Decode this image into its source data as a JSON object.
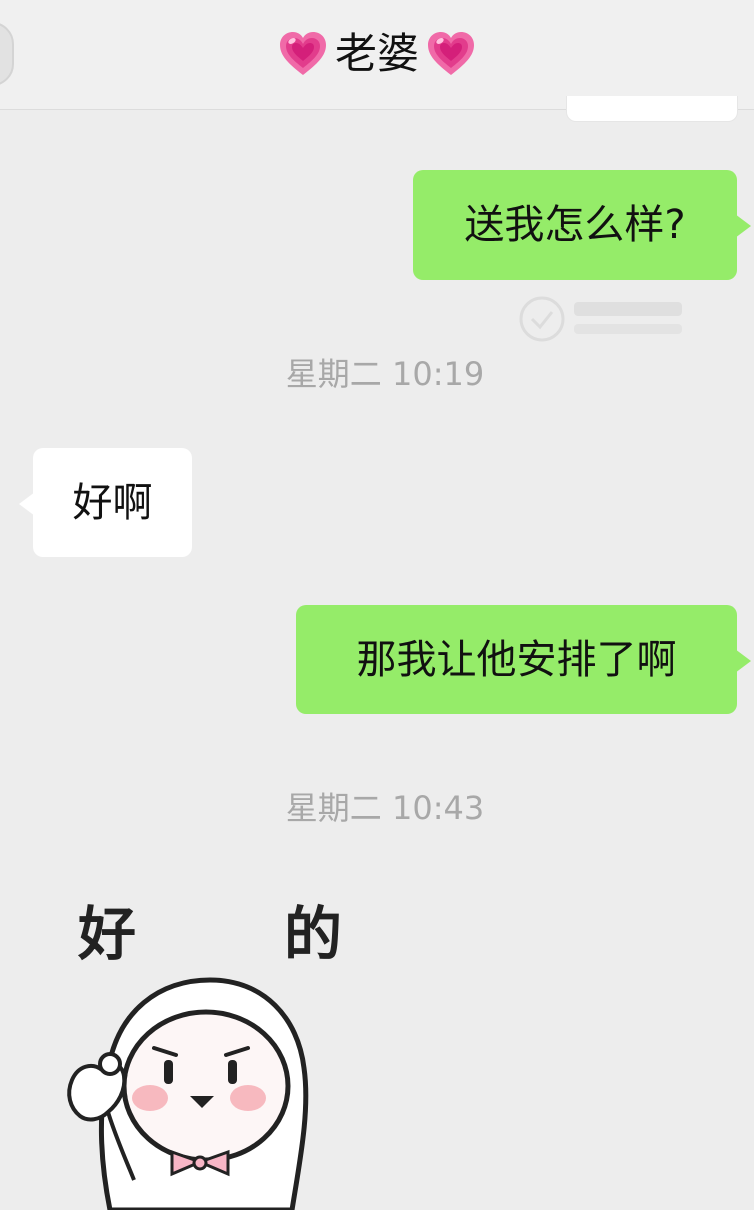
{
  "header": {
    "title": "老婆",
    "heart_icon": "growing-heart-icon",
    "heart_color": "#e8408f"
  },
  "messages": [
    {
      "side": "out",
      "text": "送我怎么样?"
    },
    {
      "timestamp": "星期二 10:19"
    },
    {
      "side": "in",
      "text": "好啊"
    },
    {
      "side": "out",
      "text": "那我让他安排了啊"
    },
    {
      "timestamp": "星期二 10:43"
    },
    {
      "side": "in",
      "type": "sticker",
      "sticker_text_left": "好",
      "sticker_text_right": "的"
    }
  ],
  "colors": {
    "background": "#ededed",
    "outgoing_bubble": "#95ec69",
    "incoming_bubble": "#ffffff",
    "timestamp": "#a8a8a8"
  }
}
